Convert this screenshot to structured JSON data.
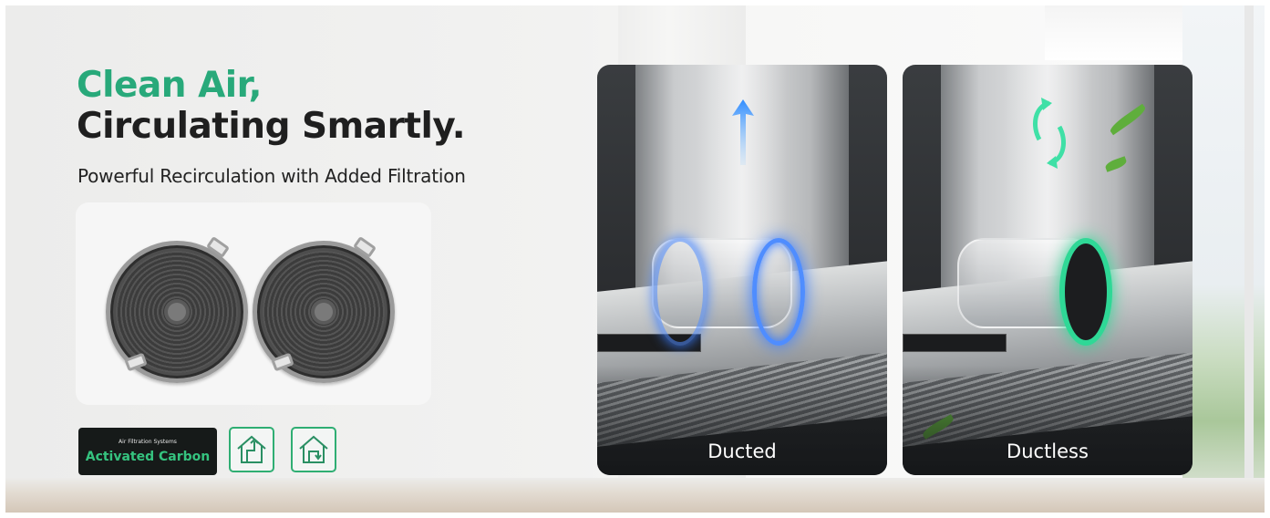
{
  "hero": {
    "title_line1": "Clean Air,",
    "title_line2": "Circulating Smartly.",
    "subtitle": "Powerful Recirculation with Added Filtration"
  },
  "badge": {
    "small_text": "Air Filtration Systems",
    "main_text": "Activated Carbon"
  },
  "panels": [
    {
      "label": "Ducted",
      "arrow_color": "#3aa0ff"
    },
    {
      "label": "Ductless",
      "arrow_color": "#3fe0a6"
    }
  ],
  "colors": {
    "accent_green": "#28a97a",
    "headline_dark": "#1f1f1f",
    "badge_bg": "#161a19",
    "badge_text": "#35c37f",
    "ducted_glow": "#3a7dff",
    "ductless_glow": "#2fd896"
  },
  "icons": [
    "carbon-filter-icon",
    "house-ducted-icon",
    "house-ductless-icon",
    "up-arrow-icon",
    "recirculation-arrows-icon",
    "leaf-icon"
  ]
}
